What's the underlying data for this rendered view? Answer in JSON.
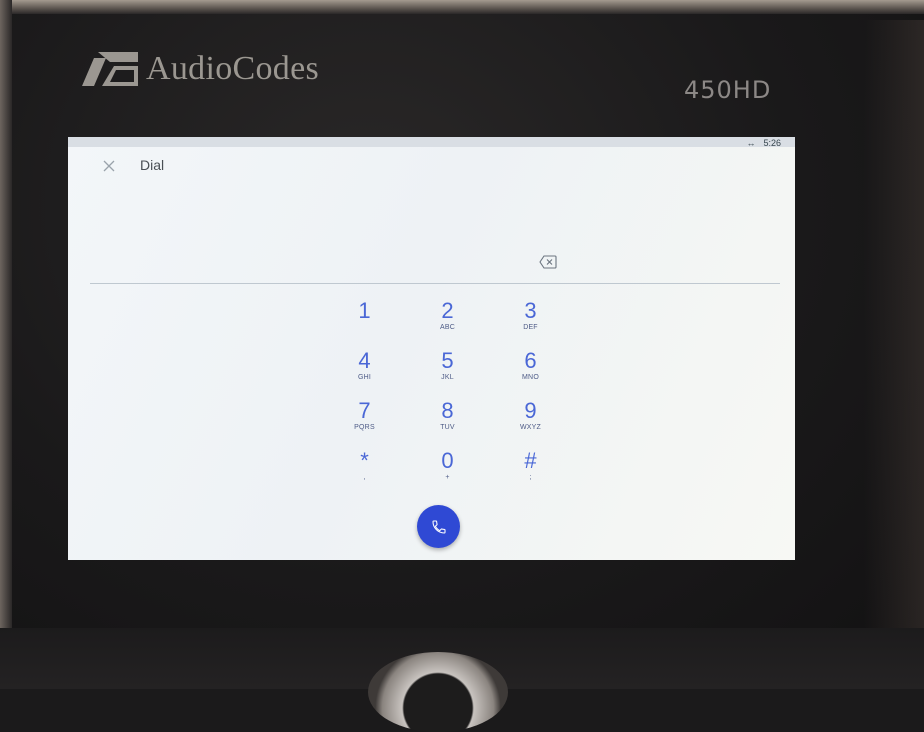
{
  "device": {
    "brand": "AudioCodes",
    "model": "450HD"
  },
  "status_bar": {
    "signal": "↔",
    "time": "5:26"
  },
  "header": {
    "close_icon": "close-icon",
    "title": "Dial"
  },
  "dial_input": {
    "value": "",
    "backspace_icon": "backspace-icon"
  },
  "keypad": {
    "keys": [
      {
        "digit": "1",
        "letters": ""
      },
      {
        "digit": "2",
        "letters": "ABC"
      },
      {
        "digit": "3",
        "letters": "DEF"
      },
      {
        "digit": "4",
        "letters": "GHI"
      },
      {
        "digit": "5",
        "letters": "JKL"
      },
      {
        "digit": "6",
        "letters": "MNO"
      },
      {
        "digit": "7",
        "letters": "PQRS"
      },
      {
        "digit": "8",
        "letters": "TUV"
      },
      {
        "digit": "9",
        "letters": "WXYZ"
      },
      {
        "digit": "*",
        "letters": ","
      },
      {
        "digit": "0",
        "letters": "+"
      },
      {
        "digit": "#",
        "letters": ";"
      }
    ]
  },
  "call_button": {
    "icon": "phone-icon",
    "color": "#2f49d4"
  },
  "colors": {
    "keypad_digit": "#4a67d6",
    "screen_bg": "#f3f6f9"
  }
}
